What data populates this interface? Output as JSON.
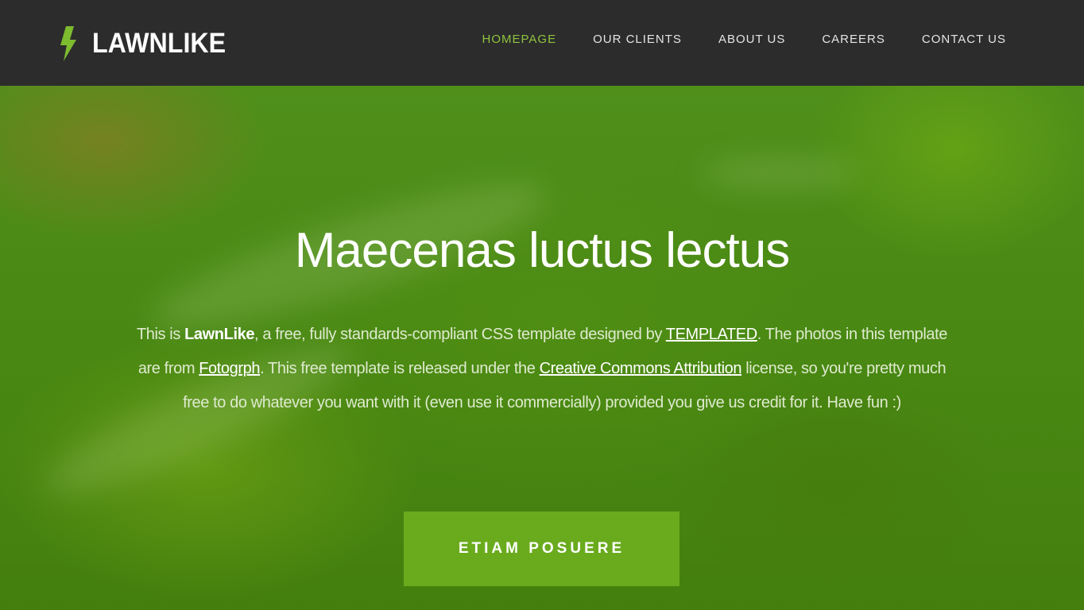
{
  "brand": {
    "name": "LAWNLIKE",
    "icon": "lightning-bolt-icon",
    "icon_color": "#7dbb2f"
  },
  "nav": {
    "items": [
      {
        "label": "HOMEPAGE",
        "active": true
      },
      {
        "label": "OUR CLIENTS",
        "active": false
      },
      {
        "label": "ABOUT US",
        "active": false
      },
      {
        "label": "CAREERS",
        "active": false
      },
      {
        "label": "CONTACT US",
        "active": false
      }
    ],
    "active_color": "#8fc43f"
  },
  "hero": {
    "title": "Maecenas luctus lectus",
    "paragraph": {
      "t1": "This is ",
      "brand": "LawnLike",
      "t2": ", a free, fully standards-compliant CSS template designed by ",
      "link1": "TEMPLATED",
      "t3": ". The photos in this template are from ",
      "link2": "Fotogrph",
      "t4": ". This free template is released under the ",
      "link3": "Creative Commons Attribution",
      "t5": " license, so you're pretty much free to do whatever you want with it (even use it commercially) provided you give us credit for it. Have fun :)"
    },
    "button_label": "ETIAM POSUERE"
  },
  "colors": {
    "header_bg": "#2c2c2c",
    "banner_green": "#4a8a14",
    "button_bg": "#6aab1e"
  }
}
